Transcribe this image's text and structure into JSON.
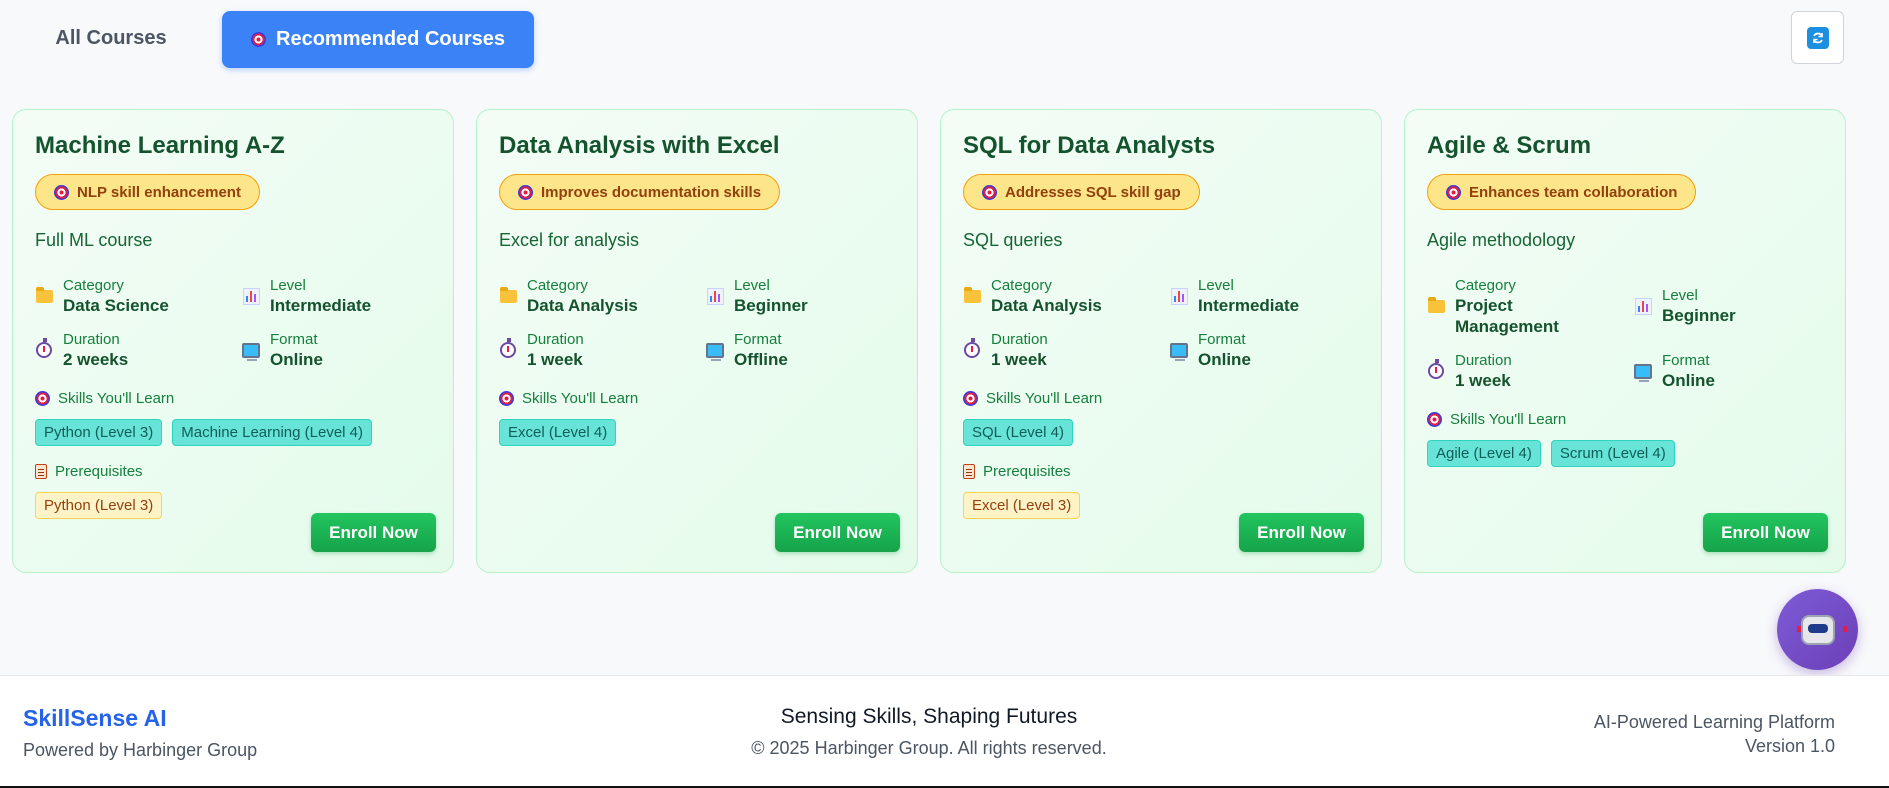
{
  "tabs": {
    "all_label": "All Courses",
    "recommended_label": "Recommended Courses"
  },
  "labels": {
    "category": "Category",
    "level": "Level",
    "duration": "Duration",
    "format": "Format",
    "skills": "Skills You'll Learn",
    "prerequisites": "Prerequisites",
    "enroll": "Enroll Now"
  },
  "courses": [
    {
      "title": "Machine Learning A-Z",
      "reason": "NLP skill enhancement",
      "description": "Full ML course",
      "category": "Data Science",
      "level": "Intermediate",
      "duration": "2 weeks",
      "format": "Online",
      "skills": [
        "Python (Level 3)",
        "Machine Learning (Level 4)"
      ],
      "prerequisites": [
        "Python (Level 3)"
      ]
    },
    {
      "title": "Data Analysis with Excel",
      "reason": "Improves documentation skills",
      "description": "Excel for analysis",
      "category": "Data Analysis",
      "level": "Beginner",
      "duration": "1 week",
      "format": "Offline",
      "skills": [
        "Excel (Level 4)"
      ],
      "prerequisites": []
    },
    {
      "title": "SQL for Data Analysts",
      "reason": "Addresses SQL skill gap",
      "description": "SQL queries",
      "category": "Data Analysis",
      "level": "Intermediate",
      "duration": "1 week",
      "format": "Online",
      "skills": [
        "SQL (Level 4)"
      ],
      "prerequisites": [
        "Excel (Level 3)"
      ]
    },
    {
      "title": "Agile & Scrum",
      "reason": "Enhances team collaboration",
      "description": "Agile methodology",
      "category_line1": "Project",
      "category_line2": "Management",
      "level": "Beginner",
      "duration": "1 week",
      "format": "Online",
      "skills": [
        "Agile (Level 4)",
        "Scrum (Level 4)"
      ],
      "prerequisites": []
    }
  ],
  "footer": {
    "brand": "SkillSense AI",
    "powered_by": "Powered by Harbinger Group",
    "tagline": "Sensing Skills, Shaping Futures",
    "copyright": "© 2025 Harbinger Group. All rights reserved.",
    "platform": "AI-Powered Learning Platform",
    "version": "Version 1.0"
  },
  "icons": {
    "refresh": "refresh-icon",
    "target": "target-icon",
    "category": "folder-icon",
    "level": "bar-chart-icon",
    "duration": "stopwatch-icon",
    "format": "monitor-icon",
    "prerequisites": "clipboard-icon",
    "assistant": "robot-icon"
  },
  "colors": {
    "primary": "#3b82f6",
    "enroll": "#16a34a",
    "brand": "#2563eb",
    "assistant": "#6d3fb8"
  }
}
